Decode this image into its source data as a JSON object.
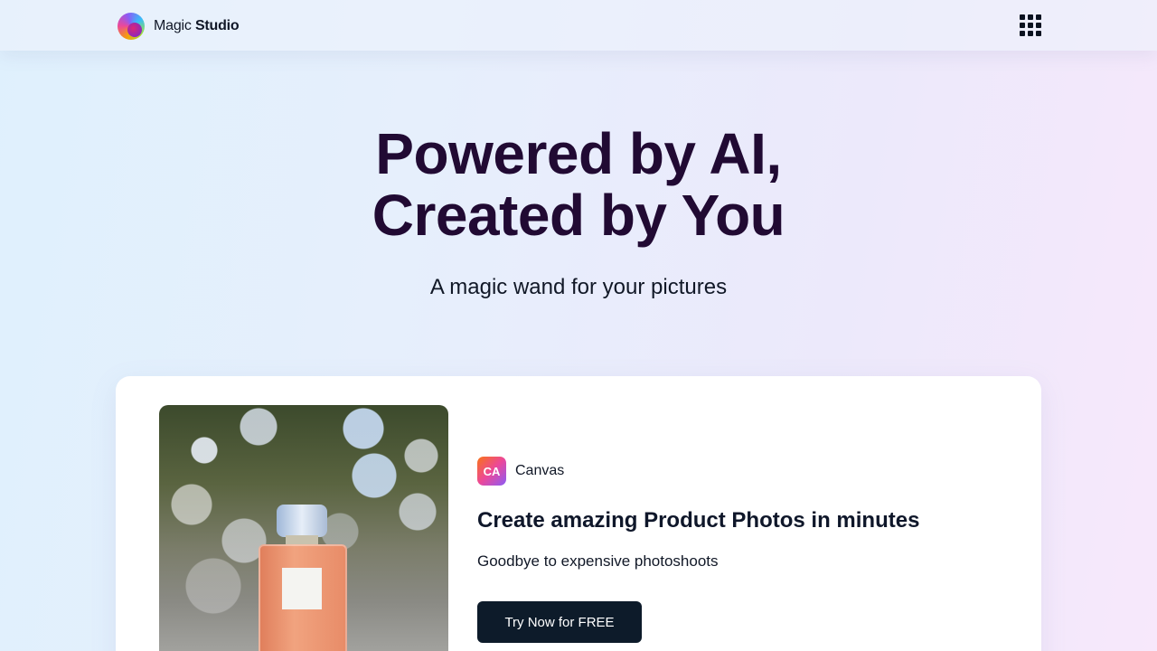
{
  "nav": {
    "brand_prefix": "Magic",
    "brand_bold": "Studio",
    "logo_icon": "magic-studio-logo",
    "apps_icon": "grid-apps-icon"
  },
  "hero": {
    "title_line1": "Powered by AI,",
    "title_line2": "Created by You",
    "subtitle": "A magic wand for your pictures"
  },
  "feature_card": {
    "image_alt": "perfume-bottle-product-photo",
    "badge_icon_text": "CA",
    "badge_label": "Canvas",
    "title": "Create amazing Product Photos in minutes",
    "subtitle": "Goodbye to expensive photoshoots",
    "cta_label": "Try Now for FREE"
  },
  "colors": {
    "hero_title": "#210a33",
    "cta_bg": "#0d1b2a"
  }
}
